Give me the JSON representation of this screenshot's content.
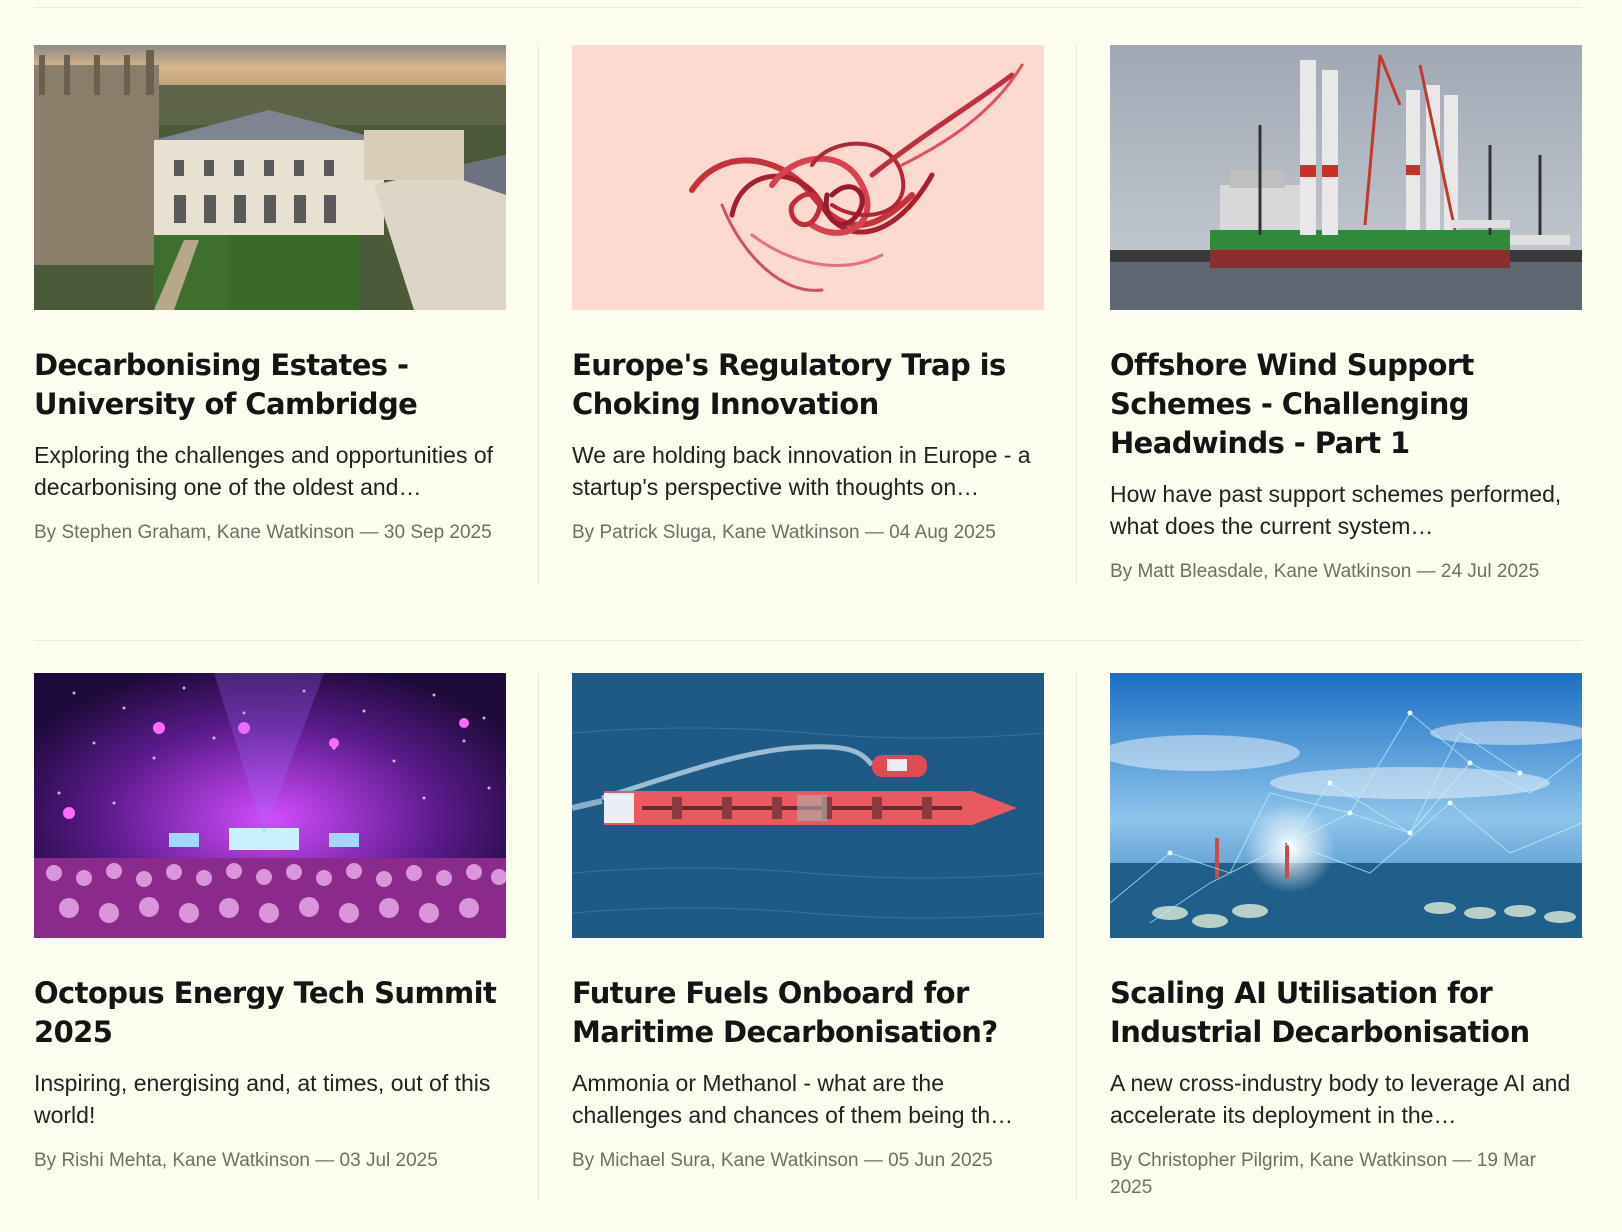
{
  "articles": [
    {
      "image": "cambridge-university-aerial-photo",
      "title": "Decarbonising Estates - University of Cambridge",
      "excerpt": "Exploring the challenges and opportunities of decarbonising one of the oldest and…",
      "byline": "By Stephen Graham, Kane Watkinson — 30 Sep 2025"
    },
    {
      "image": "red-tangled-ribbon-photo",
      "title": "Europe's Regulatory Trap is Choking Innovation",
      "excerpt": "We are holding back innovation in Europe - a startup's perspective with thoughts on…",
      "byline": "By Patrick Sluga, Kane Watkinson — 04 Aug 2025"
    },
    {
      "image": "offshore-wind-installation-vessel-photo",
      "title": "Offshore Wind Support Schemes - Challenging Headwinds - Part 1",
      "excerpt": "How have past support schemes performed, what does the current system…",
      "byline": "By Matt Bleasdale, Kane Watkinson — 24 Jul 2025"
    },
    {
      "image": "tech-summit-stage-crowd-photo",
      "title": "Octopus Energy Tech Summit 2025",
      "excerpt": "Inspiring, energising and, at times, out of this world!",
      "byline": "By Rishi Mehta, Kane Watkinson — 03 Jul 2025"
    },
    {
      "image": "tanker-ship-aerial-photo",
      "title": "Future Fuels Onboard for Maritime Decarbonisation?",
      "excerpt": "Ammonia or Methanol - what are the challenges and chances of them being th…",
      "byline": "By Michael Sura, Kane Watkinson — 05 Jun 2025"
    },
    {
      "image": "industrial-network-overlay-photo",
      "title": "Scaling AI Utilisation for Industrial Decarbonisation",
      "excerpt": "A new cross-industry body to leverage AI and accelerate its deployment in the…",
      "byline": "By Christopher Pilgrim, Kane Watkinson — 19 Mar 2025"
    }
  ],
  "colors": {
    "background": "#fdfdef",
    "title": "#141414",
    "excerpt": "#222222",
    "byline": "#6e6e64",
    "rule": "#ebebdc"
  }
}
